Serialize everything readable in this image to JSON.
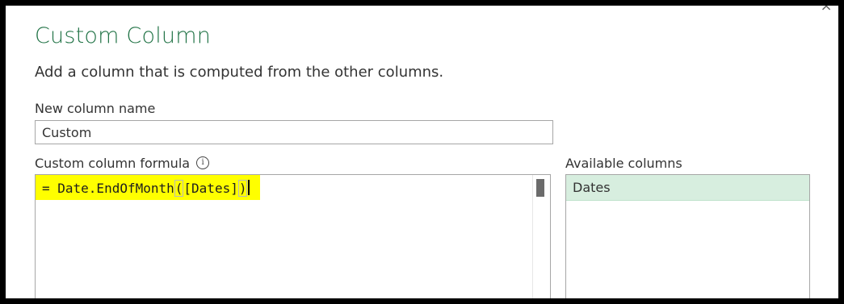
{
  "dialog": {
    "title": "Custom Column",
    "subtitle": "Add a column that is computed from the other columns.",
    "close_icon": "×"
  },
  "name_field": {
    "label": "New column name",
    "value": "Custom"
  },
  "formula": {
    "label": "Custom column formula",
    "info_icon": "i",
    "prefix": "= Date.EndOfMonth",
    "open_paren": "(",
    "argument": "[Dates]",
    "close_paren": ")",
    "highlight_color": "#ffff00"
  },
  "available_columns": {
    "label": "Available columns",
    "items": [
      "Dates"
    ],
    "selected_color": "#d7eedf"
  },
  "colors": {
    "title": "#217346",
    "background": "#000000"
  }
}
